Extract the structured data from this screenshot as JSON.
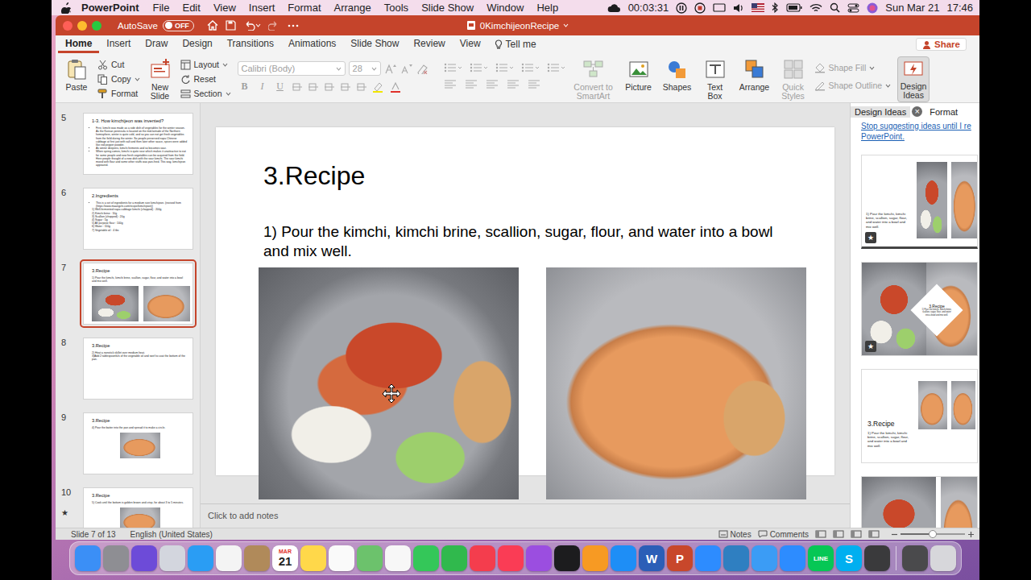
{
  "menubar": {
    "app": "PowerPoint",
    "items": [
      "File",
      "Edit",
      "View",
      "Insert",
      "Format",
      "Arrange",
      "Tools",
      "Slide Show",
      "Window",
      "Help"
    ],
    "timer": "00:03:31",
    "date": "Sun Mar 21",
    "time": "17:46"
  },
  "window": {
    "autosave": {
      "label": "AutoSave",
      "state": "OFF",
      "on": false
    },
    "title": "0KimchijeonRecipe"
  },
  "tabs": [
    {
      "label": "Home",
      "selected": true
    },
    {
      "label": "Insert",
      "selected": false
    },
    {
      "label": "Draw",
      "selected": false
    },
    {
      "label": "Design",
      "selected": false
    },
    {
      "label": "Transitions",
      "selected": false
    },
    {
      "label": "Animations",
      "selected": false
    },
    {
      "label": "Slide Show",
      "selected": false
    },
    {
      "label": "Review",
      "selected": false
    },
    {
      "label": "View",
      "selected": false
    }
  ],
  "tell_me": "Tell me",
  "share": "Share",
  "ribbon": {
    "paste": "Paste",
    "clipboard": [
      {
        "label": "Cut",
        "disabled": false
      },
      {
        "label": "Copy",
        "disabled": false
      },
      {
        "label": "Format",
        "disabled": false
      }
    ],
    "new_slide": "New Slide",
    "slides_group": [
      {
        "label": "Layout"
      },
      {
        "label": "Reset"
      },
      {
        "label": "Section"
      }
    ],
    "font": {
      "name": "Calibri (Body)",
      "size": "28",
      "disabled": true
    },
    "font_styles": [
      {
        "label": "B",
        "disabled": true
      },
      {
        "label": "I",
        "disabled": true
      },
      {
        "label": "U",
        "disabled": true
      }
    ],
    "smartart": {
      "label": "Convert to SmartArt",
      "disabled": true
    },
    "insert": [
      {
        "label": "Picture"
      },
      {
        "label": "Shapes"
      },
      {
        "label": "Text Box"
      }
    ],
    "arrange": {
      "label": "Arrange",
      "disabled": false
    },
    "quick_styles": {
      "label": "Quick Styles",
      "disabled": true
    },
    "shape_format": [
      {
        "label": "Shape Fill",
        "disabled": true
      },
      {
        "label": "Shape Outline",
        "disabled": true
      }
    ],
    "design_ideas": {
      "label": "Design Ideas",
      "selected": true
    }
  },
  "slides": [
    {
      "number": "5",
      "title": "1-3. How kimchijeon was invented?",
      "lines": [
        {
          "text": "First, kimchi was made as a side dish of vegetables for the winter season. As the Korean peninsula is located on the mid-latitude of the Northern hemisphere, winter is quite cold, and so you can not get fresh vegetables from the field during the winter. So people preserved napa Chinese cabbage at first just with salt and then later other sauce, spices were added like red pepper powder.",
          "bullet": true
        },
        {
          "text": "As winter deepens, kimchi ferments and so becomes sour.",
          "bullet": true
        },
        {
          "text": "When spring comes, kimchi is quite sour which makes it unattractive to eat for some people and now fresh vegetables can be acquired from the field. Here people thought of a new dish with the sour kimchi. The sour kimchi mixed with flour and some other stuffs was pan-fried. This way, kimchijeon appeared.",
          "bullet": true
        }
      ],
      "photos": 0,
      "selected": false,
      "has_transition": false
    },
    {
      "number": "6",
      "title": "2.Ingredients",
      "lines": [
        {
          "text": "This is a set of ingredients for a medium size kimchijeon. (revised from (https://www.maangchi.com/recipe/kimchijeon))",
          "bullet": true
        },
        {
          "text": "1) Well-fermented napa cabbage kimchi (chopped) : 200g",
          "bullet": false
        },
        {
          "text": "2) Kimchi brine : 10g",
          "bullet": false
        },
        {
          "text": "3) Scallion (chopped) : 20g",
          "bullet": false
        },
        {
          "text": "4) Sugar : 5g",
          "bullet": false
        },
        {
          "text": "5) All purpose flour : 100g",
          "bullet": false
        },
        {
          "text": "6) Water : 110g",
          "bullet": false
        },
        {
          "text": "7) Vegetable oil : 4 tbs",
          "bullet": false
        }
      ],
      "photos": 0,
      "selected": false,
      "has_transition": false
    },
    {
      "number": "7",
      "title": "3.Recipe",
      "lines": [
        {
          "text": "1) Pour the kimchi, kimchi brine, scallion, sugar, flour, and water into a bowl and mix well.",
          "bullet": false
        }
      ],
      "photos": 2,
      "selected": true,
      "has_transition": false
    },
    {
      "number": "8",
      "title": "3.Recipe",
      "lines": [
        {
          "text": "2) Heat a nonstick skillet over medium heat.",
          "bullet": false
        },
        {
          "text": "3)Add 2 tablespoonfuls of the vegetable oil and swirl to coat the bottom of the pan.",
          "bullet": false
        }
      ],
      "photos": 0,
      "selected": false,
      "has_transition": false
    },
    {
      "number": "9",
      "title": "3.Recipe",
      "lines": [
        {
          "text": "4) Pour the batter into the pan and spread it to make a circle.",
          "bullet": false
        }
      ],
      "photos": 1,
      "selected": false,
      "has_transition": false
    },
    {
      "number": "10",
      "title": "3.Recipe",
      "lines": [
        {
          "text": "5) Cook until the bottom is golden brown and crisp, for about 3 to 5 minutes.",
          "bullet": false
        }
      ],
      "photos": 1,
      "selected": false,
      "has_transition": true
    }
  ],
  "transition_mark": "★",
  "slide": {
    "title": "3.Recipe",
    "body": "1) Pour the kimchi, kimchi brine, scallion, sugar, flour, and water into a bowl and mix well.",
    "photos": 2
  },
  "notes": {
    "placeholder": "Click to add notes"
  },
  "design_pane": {
    "tabs": [
      {
        "label": "Design Ideas",
        "selected": true
      },
      {
        "label": "Format",
        "selected": false
      }
    ],
    "close": "×",
    "link": "Stop suggesting ideas until I re",
    "link_end": "PowerPoint.",
    "badge": "★",
    "ideas": [
      {
        "kind": "side",
        "text": "1) Pour the kimchi, kimchi brine, scallion, sugar, flour, and water into a bowl and mix well.",
        "starred": true,
        "selected": true
      },
      {
        "kind": "diamond",
        "title": "3.Recipe",
        "text": "1) Pour the kimchi, kimchi brine, scallion, sugar, flour, and water into a bowl and mix well.",
        "starred": true,
        "selected": false
      },
      {
        "kind": "card",
        "title": "3.Recipe",
        "text": "1) Pour the kimchi, kimchi brine, scallion, sugar, flour, and water into a bowl and mix well.",
        "starred": false,
        "selected": false
      },
      {
        "kind": "photos",
        "starred": false,
        "selected": false
      }
    ]
  },
  "status_bar": {
    "slide": "Slide 7 of 13",
    "language": "English (United States)",
    "notes": "Notes",
    "comments": "Comments",
    "zoom_level": 0.5
  },
  "dock": [
    {
      "kind": "app",
      "color": "#3b8ff6"
    },
    {
      "kind": "app",
      "color": "#8e8e93"
    },
    {
      "kind": "app",
      "color": "#6d4bd8"
    },
    {
      "kind": "app",
      "color": "#d3d6de"
    },
    {
      "kind": "app",
      "color": "#2a9df4"
    },
    {
      "kind": "app",
      "color": "#f4f4f4"
    },
    {
      "kind": "app",
      "color": "#b08a5a"
    },
    {
      "kind": "calendar",
      "color": "#ffffff",
      "month": "MAR",
      "day": "21"
    },
    {
      "kind": "app",
      "color": "#ffd84a"
    },
    {
      "kind": "app",
      "color": "#fafafa"
    },
    {
      "kind": "app",
      "color": "#6cc26c"
    },
    {
      "kind": "app",
      "color": "#f7f7f7"
    },
    {
      "kind": "app",
      "color": "#34c759"
    },
    {
      "kind": "app",
      "color": "#30b94d"
    },
    {
      "kind": "app",
      "color": "#f43d4d"
    },
    {
      "kind": "app",
      "color": "#fa3c55"
    },
    {
      "kind": "app",
      "color": "#9b4ee0"
    },
    {
      "kind": "app",
      "color": "#1c1c1e"
    },
    {
      "kind": "app",
      "color": "#f79a23"
    },
    {
      "kind": "app",
      "color": "#1e8ef6"
    },
    {
      "kind": "app",
      "color": "#2b5eb7",
      "glyph": "W"
    },
    {
      "kind": "app",
      "color": "#c8472b",
      "glyph": "P"
    },
    {
      "kind": "app",
      "color": "#2d8cff"
    },
    {
      "kind": "app",
      "color": "#2f7fc1"
    },
    {
      "kind": "app",
      "color": "#3b9cf5"
    },
    {
      "kind": "app",
      "color": "#2d8cff"
    },
    {
      "kind": "app",
      "color": "#06c755",
      "glyph": "LINE"
    },
    {
      "kind": "app",
      "color": "#00aff0",
      "glyph": "S"
    },
    {
      "kind": "app",
      "color": "#3a3a3c"
    },
    {
      "kind": "separator"
    },
    {
      "kind": "app",
      "color": "#4a4a4c"
    },
    {
      "kind": "app",
      "color": "#d7d7db"
    }
  ]
}
